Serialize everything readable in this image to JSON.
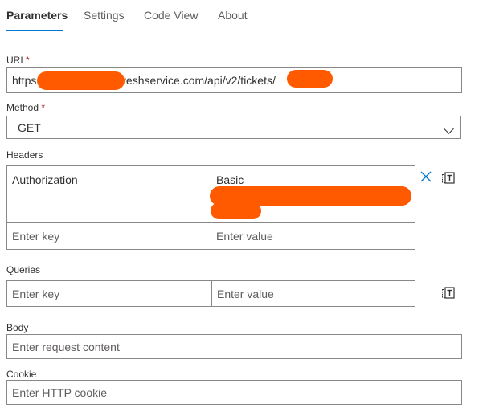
{
  "tabs": [
    {
      "label": "Parameters"
    },
    {
      "label": "Settings"
    },
    {
      "label": "Code View"
    },
    {
      "label": "About"
    }
  ],
  "uri": {
    "label": "URI",
    "required_mark": "*",
    "value_prefix": "https:",
    "value_middle": "reshservice.com/api/v2/tickets/"
  },
  "method": {
    "label": "Method",
    "required_mark": "*",
    "value": "GET"
  },
  "headers": {
    "label": "Headers",
    "rows": [
      {
        "key": "Authorization",
        "value": "Basic"
      }
    ],
    "key_placeholder": "Enter key",
    "value_placeholder": "Enter value"
  },
  "queries": {
    "label": "Queries",
    "key_placeholder": "Enter key",
    "value_placeholder": "Enter value"
  },
  "body": {
    "label": "Body",
    "placeholder": "Enter request content"
  },
  "cookie": {
    "label": "Cookie",
    "placeholder": "Enter HTTP cookie"
  },
  "colors": {
    "accent": "#0078d4",
    "redaction": "#ff5a00",
    "required": "#a4262c"
  },
  "icons": {
    "remove_row": "close-icon",
    "switch_mode": "text-mode-icon"
  }
}
